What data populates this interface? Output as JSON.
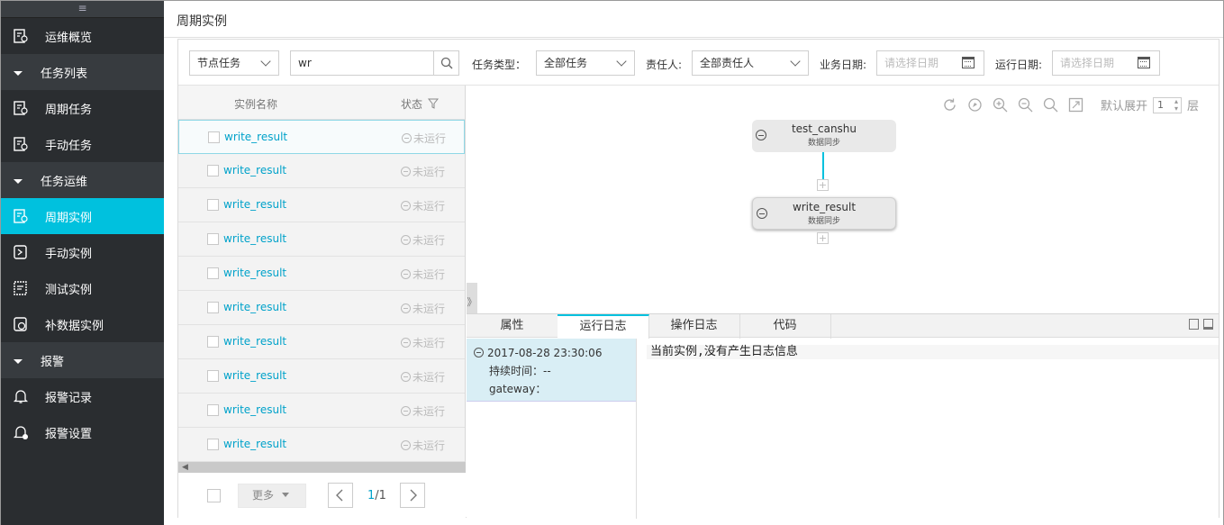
{
  "sidebar": {
    "handle": "≡",
    "items": [
      {
        "label": "运维概览",
        "type": "item",
        "icon": "overview-icon"
      },
      {
        "label": "任务列表",
        "type": "group"
      },
      {
        "label": "周期任务",
        "type": "item",
        "icon": "task-icon"
      },
      {
        "label": "手动任务",
        "type": "item",
        "icon": "task-icon"
      },
      {
        "label": "任务运维",
        "type": "group"
      },
      {
        "label": "周期实例",
        "type": "item",
        "icon": "instance-icon",
        "active": true
      },
      {
        "label": "手动实例",
        "type": "item",
        "icon": "instance-icon"
      },
      {
        "label": "测试实例",
        "type": "item",
        "icon": "test-icon"
      },
      {
        "label": "补数据实例",
        "type": "item",
        "icon": "backfill-icon"
      },
      {
        "label": "报警",
        "type": "group"
      },
      {
        "label": "报警记录",
        "type": "item",
        "icon": "bell-icon"
      },
      {
        "label": "报警设置",
        "type": "item",
        "icon": "bell-settings-icon"
      }
    ]
  },
  "page": {
    "title": "周期实例"
  },
  "filter": {
    "node_type": "节点任务",
    "search_value": "wr",
    "task_type_label": "任务类型：",
    "task_type_value": "全部任务",
    "owner_label": "责任人:",
    "owner_value": "全部责任人",
    "biz_date_label": "业务日期:",
    "biz_date_placeholder": "请选择日期",
    "run_date_label": "运行日期:",
    "run_date_placeholder": "请选择日期"
  },
  "list": {
    "col_name": "实例名称",
    "col_status": "状态",
    "rows": [
      {
        "name": "write_result",
        "status": "未运行"
      },
      {
        "name": "write_result",
        "status": "未运行"
      },
      {
        "name": "write_result",
        "status": "未运行"
      },
      {
        "name": "write_result",
        "status": "未运行"
      },
      {
        "name": "write_result",
        "status": "未运行"
      },
      {
        "name": "write_result",
        "status": "未运行"
      },
      {
        "name": "write_result",
        "status": "未运行"
      },
      {
        "name": "write_result",
        "status": "未运行"
      },
      {
        "name": "write_result",
        "status": "未运行"
      },
      {
        "name": "write_result",
        "status": "未运行"
      }
    ],
    "more_label": "更多",
    "page_current": "1",
    "page_total": "/1"
  },
  "graph": {
    "expand_label": "默认展开",
    "expand_value": "1",
    "expand_unit": "层",
    "nodes": [
      {
        "name": "test_canshu",
        "type": "数据同步"
      },
      {
        "name": "write_result",
        "type": "数据同步"
      }
    ]
  },
  "bottom": {
    "tabs": [
      "属性",
      "运行日志",
      "操作日志",
      "代码"
    ],
    "active_tab": "运行日志",
    "log_time": "2017-08-28 23:30:06",
    "duration": "持续时间：--",
    "gateway": "gateway：",
    "message": "当前实例,没有产生日志信息"
  },
  "colors": {
    "accent": "#00c1de",
    "sidebar": "#2a2d30",
    "link": "#00a2ca"
  }
}
